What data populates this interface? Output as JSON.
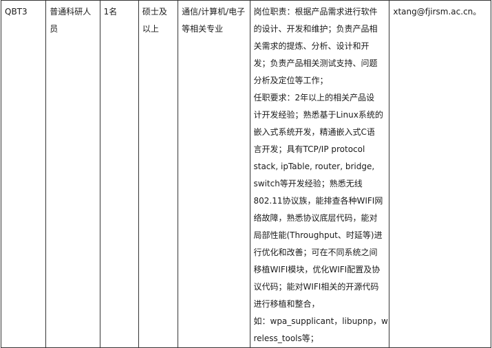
{
  "row": {
    "code": "QBT3",
    "title": "普通科研人员",
    "count": "1名",
    "degree": "硕士及以上",
    "major": "通信/计算机/电子等相关专业",
    "description_lines": [
      "岗位职责：根据产品需求进行软件",
      "的设计、开发和维护；负责产品相",
      "关需求的提炼、分析、设计和开",
      "发；负责产品相关测试支持、问题",
      "分析及定位等工作；",
      "任职要求：2年以上的相关产品设",
      "计开发经验；熟悉基于Linux系统的",
      "嵌入式系统开发，精通嵌入式C语",
      "言开发；具有TCP/IP protocol",
      "stack, ipTable, router, bridge,",
      "switch等开发经验；熟悉无线",
      "802.11协议族，能排查各种WIFI网",
      "络故障，熟悉协议底层代码，能对",
      "局部性能(Throughput、时延等)进",
      "行优化和改善；可在不同系统之间",
      "移植WIFI模块，优化WIFI配置及协",
      "议代码；能对WIFI相关的开源代码",
      "进行移植和整合，",
      "如：wpa_supplicant，libupnp，wi",
      "reless_tools等；"
    ],
    "contact": "xtang@fjirsm.ac.cn。"
  }
}
